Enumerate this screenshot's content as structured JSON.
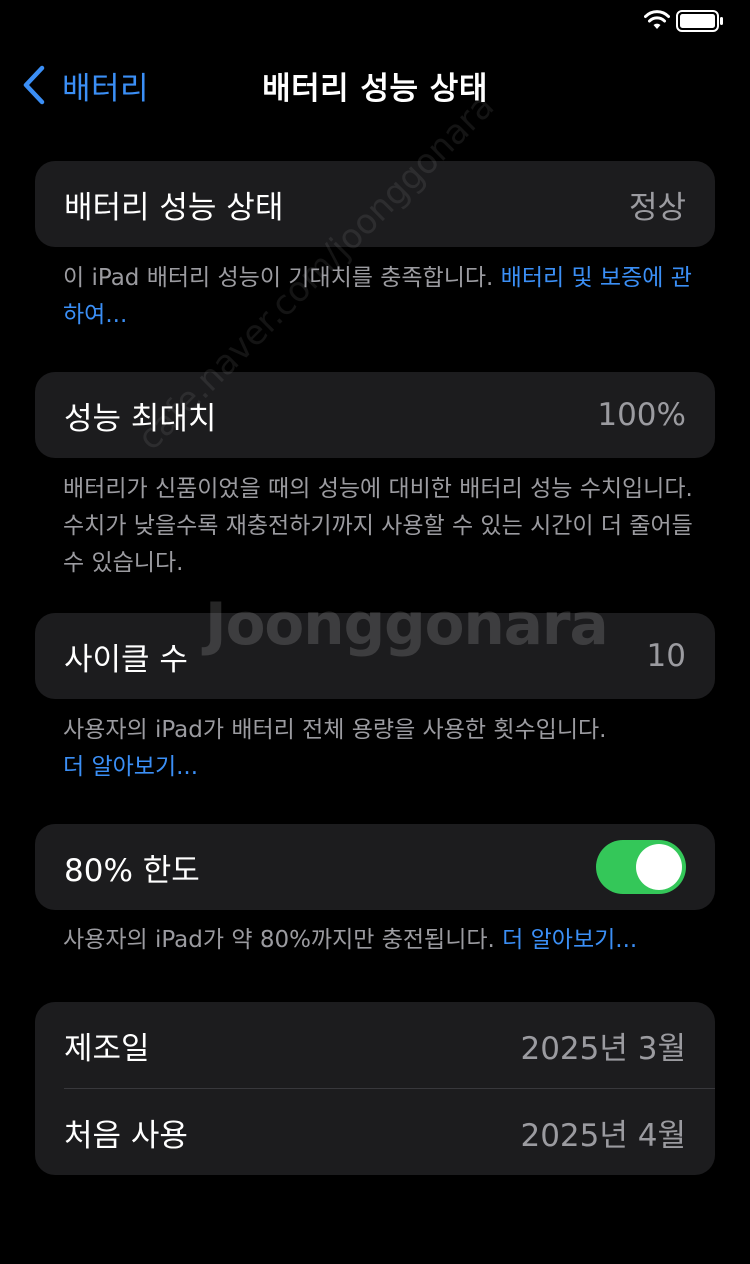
{
  "nav": {
    "back_label": "배터리",
    "title": "배터리 성능 상태"
  },
  "battery_health": {
    "label": "배터리 성능 상태",
    "value": "정상",
    "footer_text": "이 iPad 배터리 성능이 기대치를 충족합니다. ",
    "footer_link": "배터리 및 보증에 관하여..."
  },
  "max_capacity": {
    "label": "성능 최대치",
    "value": "100%",
    "footer_text": "배터리가 신품이었을 때의 성능에 대비한 배터리 성능 수치입니다. 수치가 낮을수록 재충전하기까지 사용할 수 있는 시간이 더 줄어들 수 있습니다."
  },
  "cycle_count": {
    "label": "사이클 수",
    "value": "10",
    "footer_text": "사용자의 iPad가 배터리 전체 용량을 사용한 횟수입니다.",
    "footer_link": "더 알아보기..."
  },
  "limit_80": {
    "label": "80% 한도",
    "enabled": true,
    "footer_text": "사용자의 iPad가 약 80%까지만 충전됩니다. ",
    "footer_link": "더 알아보기..."
  },
  "dates": {
    "manufacture_label": "제조일",
    "manufacture_value": "2025년 3월",
    "first_use_label": "처음 사용",
    "first_use_value": "2025년 4월"
  },
  "watermark": {
    "brand": "Joonggonara",
    "url": "cafe.naver.com/joonggonara"
  },
  "colors": {
    "background": "#000000",
    "cell_background": "#1c1c1e",
    "accent": "#3b8ff6",
    "toggle_on": "#34c759",
    "secondary_text": "#9b9ba0"
  },
  "icons": {
    "back": "chevron-left-icon",
    "wifi": "wifi-icon",
    "battery": "battery-icon"
  }
}
